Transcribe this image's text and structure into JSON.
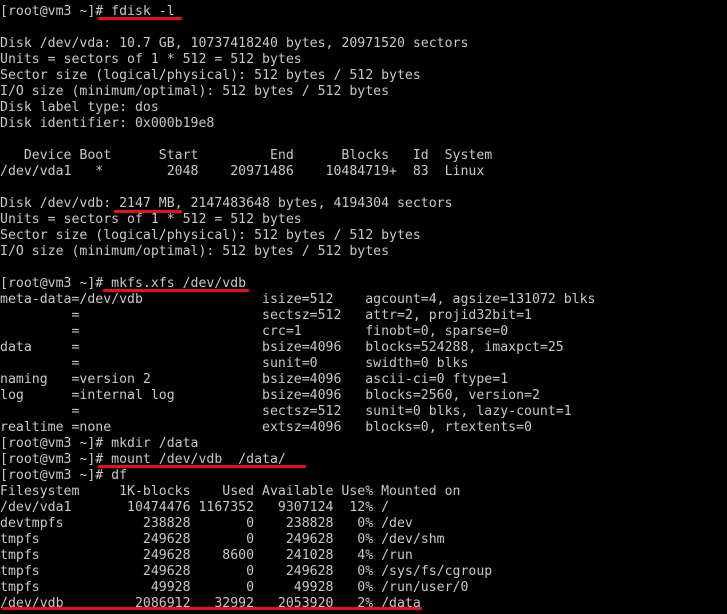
{
  "terminal": {
    "lines": [
      "[root@vm3 ~]# fdisk -l",
      "",
      "Disk /dev/vda: 10.7 GB, 10737418240 bytes, 20971520 sectors",
      "Units = sectors of 1 * 512 = 512 bytes",
      "Sector size (logical/physical): 512 bytes / 512 bytes",
      "I/O size (minimum/optimal): 512 bytes / 512 bytes",
      "Disk label type: dos",
      "Disk identifier: 0x000b19e8",
      "",
      "   Device Boot      Start         End      Blocks   Id  System",
      "/dev/vda1   *        2048    20971486    10484719+  83  Linux",
      "",
      "Disk /dev/vdb: 2147 MB, 2147483648 bytes, 4194304 sectors",
      "Units = sectors of 1 * 512 = 512 bytes",
      "Sector size (logical/physical): 512 bytes / 512 bytes",
      "I/O size (minimum/optimal): 512 bytes / 512 bytes",
      "",
      "[root@vm3 ~]# mkfs.xfs /dev/vdb",
      "meta-data=/dev/vdb               isize=512    agcount=4, agsize=131072 blks",
      "         =                       sectsz=512   attr=2, projid32bit=1",
      "         =                       crc=1        finobt=0, sparse=0",
      "data     =                       bsize=4096   blocks=524288, imaxpct=25",
      "         =                       sunit=0      swidth=0 blks",
      "naming   =version 2              bsize=4096   ascii-ci=0 ftype=1",
      "log      =internal log           bsize=4096   blocks=2560, version=2",
      "         =                       sectsz=512   sunit=0 blks, lazy-count=1",
      "realtime =none                   extsz=4096   blocks=0, rtextents=0",
      "[root@vm3 ~]# mkdir /data",
      "[root@vm3 ~]# mount /dev/vdb  /data/",
      "[root@vm3 ~]# df",
      "Filesystem     1K-blocks    Used Available Use% Mounted on",
      "/dev/vda1       10474476 1167352   9307124  12% /",
      "devtmpfs          238828       0    238828   0% /dev",
      "tmpfs             249628       0    249628   0% /dev/shm",
      "tmpfs             249628    8600    241028   4% /run",
      "tmpfs             249628       0    249628   0% /sys/fs/cgroup",
      "tmpfs              49928       0     49928   0% /run/user/0",
      "/dev/vdb         2086912   32992   2053920   2% /data"
    ]
  },
  "colors": {
    "background": "#000000",
    "text": "#c8c8c8",
    "annotation": "#e8101c"
  }
}
